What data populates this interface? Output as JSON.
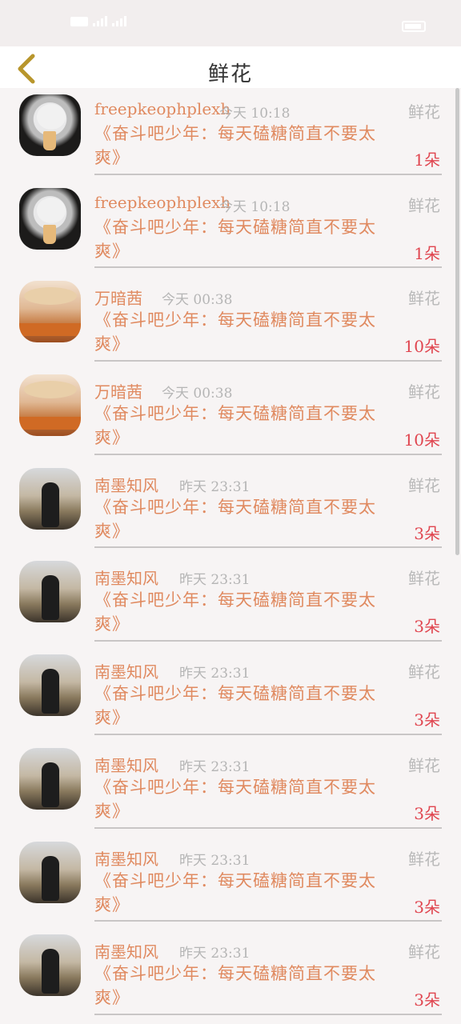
{
  "header": {
    "title": "鲜花"
  },
  "icons": {
    "back": "chevron-left-icon"
  },
  "colors": {
    "accent": "#e08a60",
    "count": "#e0454f",
    "muted": "#b5b5b5",
    "back": "#b8962c"
  },
  "rows": [
    {
      "name": "freepkeophplexh",
      "time": "今天 10:18",
      "gift": "鲜花",
      "message": "《奋斗吧少年：每天磕糖简直不要太爽》",
      "count": "1朵",
      "avatar": "cat"
    },
    {
      "name": "freepkeophplexh",
      "time": "今天 10:18",
      "gift": "鲜花",
      "message": "《奋斗吧少年：每天磕糖简直不要太爽》",
      "count": "1朵",
      "avatar": "cat"
    },
    {
      "name": "万暗茜",
      "time": "今天 00:38",
      "gift": "鲜花",
      "message": "《奋斗吧少年：每天磕糖简直不要太爽》",
      "count": "10朵",
      "avatar": "girl"
    },
    {
      "name": "万暗茜",
      "time": "今天 00:38",
      "gift": "鲜花",
      "message": "《奋斗吧少年：每天磕糖简直不要太爽》",
      "count": "10朵",
      "avatar": "girl"
    },
    {
      "name": "南墨知风",
      "time": "昨天 23:31",
      "gift": "鲜花",
      "message": "《奋斗吧少年：每天磕糖简直不要太爽》",
      "count": "3朵",
      "avatar": "man"
    },
    {
      "name": "南墨知风",
      "time": "昨天 23:31",
      "gift": "鲜花",
      "message": "《奋斗吧少年：每天磕糖简直不要太爽》",
      "count": "3朵",
      "avatar": "man"
    },
    {
      "name": "南墨知风",
      "time": "昨天 23:31",
      "gift": "鲜花",
      "message": "《奋斗吧少年：每天磕糖简直不要太爽》",
      "count": "3朵",
      "avatar": "man"
    },
    {
      "name": "南墨知风",
      "time": "昨天 23:31",
      "gift": "鲜花",
      "message": "《奋斗吧少年：每天磕糖简直不要太爽》",
      "count": "3朵",
      "avatar": "man"
    },
    {
      "name": "南墨知风",
      "time": "昨天 23:31",
      "gift": "鲜花",
      "message": "《奋斗吧少年：每天磕糖简直不要太爽》",
      "count": "3朵",
      "avatar": "man"
    },
    {
      "name": "南墨知风",
      "time": "昨天 23:31",
      "gift": "鲜花",
      "message": "《奋斗吧少年：每天磕糖简直不要太爽》",
      "count": "3朵",
      "avatar": "man"
    }
  ]
}
